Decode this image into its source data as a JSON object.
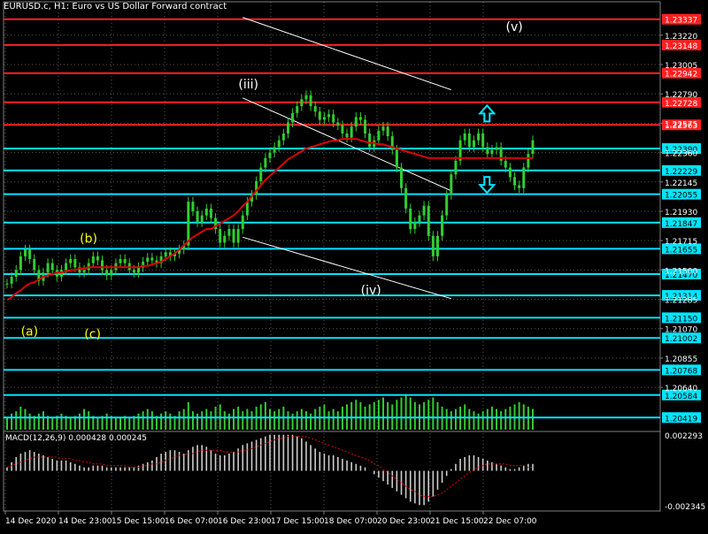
{
  "window": {
    "title": "EURUSD.c, H1:  Euro vs US Dollar Forward contract"
  },
  "colors": {
    "background": "#000000",
    "grid": "#ffffff",
    "candle": "#32cd32",
    "ma": "#e00000",
    "resistance": "#ff2020",
    "support": "#00e5ff",
    "trend": "#ffffff",
    "wave_label": "#ffff00",
    "wave_label_alt": "#ffffff",
    "macd_hist": "#cccccc",
    "macd_signal": "#e00000",
    "volume": "#32cd32",
    "arrow": "#00e5ff"
  },
  "chart_data": {
    "type": "candlestick",
    "symbol": "EURUSD.c",
    "timeframe": "H1",
    "ylim": [
      1.2033,
      1.234
    ],
    "y_ticks": [
      "1.23220",
      "1.23005",
      "1.22790",
      "1.22575",
      "1.22360",
      "1.22145",
      "1.21930",
      "1.21715",
      "1.21500",
      "1.21285",
      "1.21070",
      "1.20855",
      "1.20640"
    ],
    "x_ticks": [
      "14 Dec 2020",
      "14 Dec 23:00",
      "15 Dec 15:00",
      "16 Dec 07:00",
      "16 Dec 23:00",
      "17 Dec 15:00",
      "18 Dec 07:00",
      "20 Dec 23:00",
      "21 Dec 15:00",
      "22 Dec 07:00"
    ],
    "close_series": [
      1.214,
      1.2145,
      1.215,
      1.216,
      1.2165,
      1.2158,
      1.215,
      1.2142,
      1.2148,
      1.2155,
      1.215,
      1.2145,
      1.215,
      1.2155,
      1.2158,
      1.2152,
      1.2148,
      1.215,
      1.2155,
      1.216,
      1.2157,
      1.215,
      1.2146,
      1.215,
      1.2155,
      1.2158,
      1.2155,
      1.215,
      1.2148,
      1.2152,
      1.2156,
      1.2159,
      1.2157,
      1.2155,
      1.216,
      1.2163,
      1.216,
      1.2162,
      1.2165,
      1.2168,
      1.22,
      1.2193,
      1.2185,
      1.219,
      1.2195,
      1.2188,
      1.218,
      1.217,
      1.2175,
      1.218,
      1.217,
      1.218,
      1.219,
      1.22,
      1.2205,
      1.2215,
      1.2225,
      1.2232,
      1.2236,
      1.224,
      1.2245,
      1.225,
      1.2258,
      1.2265,
      1.227,
      1.2275,
      1.2278,
      1.227,
      1.2266,
      1.226,
      1.2262,
      1.2264,
      1.2258,
      1.2256,
      1.225,
      1.2247,
      1.2255,
      1.2262,
      1.226,
      1.225,
      1.224,
      1.2245,
      1.2252,
      1.2255,
      1.2248,
      1.2238,
      1.2225,
      1.221,
      1.2195,
      1.218,
      1.2185,
      1.219,
      1.2197,
      1.2175,
      1.216,
      1.2175,
      1.219,
      1.2205,
      1.222,
      1.223,
      1.2245,
      1.225,
      1.224,
      1.2245,
      1.225,
      1.224,
      1.2235,
      1.2238,
      1.224,
      1.223,
      1.2225,
      1.2218,
      1.2212,
      1.221,
      1.2225,
      1.2235,
      1.2245
    ],
    "ma_series": [
      1.2128,
      1.213,
      1.2133,
      1.2135,
      1.2138,
      1.214,
      1.2141,
      1.2143,
      1.2145,
      1.2146,
      1.2147,
      1.2148,
      1.2148,
      1.2149,
      1.215,
      1.215,
      1.2151,
      1.2151,
      1.2152,
      1.2152,
      1.2152,
      1.2152,
      1.2152,
      1.2152,
      1.2152,
      1.2152,
      1.2152,
      1.2152,
      1.2152,
      1.2152,
      1.2153,
      1.2153,
      1.2154,
      1.2155,
      1.2156,
      1.2158,
      1.216,
      1.2162,
      1.2165,
      1.2168,
      1.2171,
      1.2174,
      1.2176,
      1.2178,
      1.218,
      1.218,
      1.2182,
      1.2184,
      1.2186,
      1.2188,
      1.219,
      1.2193,
      1.2197,
      1.22,
      1.2204,
      1.2208,
      1.2212,
      1.2216,
      1.2219,
      1.2222,
      1.2225,
      1.2228,
      1.2231,
      1.2233,
      1.2235,
      1.2237,
      1.2239,
      1.224,
      1.2241,
      1.2242,
      1.2243,
      1.2244,
      1.2245,
      1.2245,
      1.2246,
      1.2246,
      1.2246,
      1.2246,
      1.2245,
      1.2244,
      1.2243,
      1.2243,
      1.2242,
      1.2242,
      1.2241,
      1.224,
      1.2239,
      1.2238,
      1.2237,
      1.2236,
      1.2235,
      1.2234,
      1.2233,
      1.2232,
      1.2232,
      1.2232,
      1.2232,
      1.2232,
      1.2232,
      1.2232,
      1.2232,
      1.2232,
      1.2232,
      1.2232,
      1.2232,
      1.2232,
      1.2232,
      1.2232,
      1.2232,
      1.2232,
      1.2232,
      1.2232,
      1.2232,
      1.2232,
      1.2232,
      1.2232,
      1.2232
    ],
    "horizontal_levels": [
      {
        "label": "1.23337",
        "value": 1.23337,
        "kind": "resistance"
      },
      {
        "label": "1.23148",
        "value": 1.23148,
        "kind": "resistance"
      },
      {
        "label": "1.22942",
        "value": 1.22942,
        "kind": "resistance"
      },
      {
        "label": "1.22728",
        "value": 1.22728,
        "kind": "resistance"
      },
      {
        "label": "1.22563",
        "value": 1.22563,
        "kind": "resistance"
      },
      {
        "label": "1.22390",
        "value": 1.2239,
        "kind": "support"
      },
      {
        "label": "1.22229",
        "value": 1.22229,
        "kind": "support"
      },
      {
        "label": "1.22055",
        "value": 1.22055,
        "kind": "support"
      },
      {
        "label": "1.21847",
        "value": 1.21847,
        "kind": "support"
      },
      {
        "label": "1.21655",
        "value": 1.21655,
        "kind": "support"
      },
      {
        "label": "1.21470",
        "value": 1.2147,
        "kind": "support"
      },
      {
        "label": "1.21314",
        "value": 1.21314,
        "kind": "support"
      },
      {
        "label": "1.21150",
        "value": 1.2115,
        "kind": "support"
      },
      {
        "label": "1.21002",
        "value": 1.21002,
        "kind": "support"
      },
      {
        "label": "1.20768",
        "value": 1.20768,
        "kind": "support"
      },
      {
        "label": "1.20584",
        "value": 1.20584,
        "kind": "support"
      },
      {
        "label": "1.20419",
        "value": 1.20419,
        "kind": "support"
      }
    ],
    "trendlines": [
      {
        "x1": 52,
        "y1": 1.2335,
        "x2": 98,
        "y2": 1.2282
      },
      {
        "x1": 52,
        "y1": 1.2276,
        "x2": 98,
        "y2": 1.2208
      },
      {
        "x1": 52,
        "y1": 1.2174,
        "x2": 98,
        "y2": 1.2129
      }
    ],
    "wave_labels": [
      {
        "text": "(a)",
        "bar": 5,
        "price": 1.2102,
        "style": "yellow"
      },
      {
        "text": "(b)",
        "bar": 18,
        "price": 1.217,
        "style": "yellow"
      },
      {
        "text": "(c)",
        "bar": 19,
        "price": 1.21,
        "style": "yellow"
      },
      {
        "text": "(iii)",
        "bar": 53,
        "price": 1.2283,
        "style": "white"
      },
      {
        "text": "(iv)",
        "bar": 80,
        "price": 1.2132,
        "style": "white"
      },
      {
        "text": "(v)",
        "bar": 112,
        "price": 1.2325,
        "style": "white"
      }
    ],
    "arrows": [
      {
        "direction": "up",
        "bar": 102,
        "price": 1.2264
      },
      {
        "direction": "down",
        "bar": 102,
        "price": 1.2213
      }
    ],
    "macd": {
      "label": "MACD(12,26,9) 0.000428 0.000245",
      "ylim": [
        -0.002345,
        0.002293
      ],
      "tick_labels": [
        "0.002293",
        "-0.002345"
      ],
      "histogram": [
        0.0002,
        0.0005,
        0.0008,
        0.001,
        0.0011,
        0.0012,
        0.0011,
        0.001,
        0.0009,
        0.0008,
        0.0007,
        0.0006,
        0.0006,
        0.0006,
        0.0005,
        0.0004,
        0.0003,
        0.0002,
        0.0002,
        0.0003,
        0.0003,
        0.0003,
        0.0002,
        0.0002,
        0.0002,
        0.0002,
        0.0002,
        0.0002,
        0.0002,
        0.0003,
        0.0004,
        0.0005,
        0.0006,
        0.0008,
        0.001,
        0.0011,
        0.0012,
        0.0012,
        0.0011,
        0.001,
        0.0012,
        0.0014,
        0.0015,
        0.0015,
        0.0014,
        0.0012,
        0.001,
        0.0009,
        0.0009,
        0.001,
        0.0011,
        0.0013,
        0.0015,
        0.0016,
        0.0017,
        0.0018,
        0.0019,
        0.002,
        0.0021,
        0.0021,
        0.0021,
        0.0021,
        0.0021,
        0.0021,
        0.002,
        0.0019,
        0.0017,
        0.0015,
        0.0013,
        0.0011,
        0.001,
        0.0009,
        0.0009,
        0.0008,
        0.0007,
        0.0006,
        0.0005,
        0.0004,
        0.0003,
        0.0002,
        0.0,
        -0.0002,
        -0.0004,
        -0.0006,
        -0.0008,
        -0.001,
        -0.0012,
        -0.0014,
        -0.0016,
        -0.0018,
        -0.0019,
        -0.002,
        -0.002,
        -0.0018,
        -0.0015,
        -0.0011,
        -0.0007,
        -0.0003,
        0.0001,
        0.0004,
        0.0007,
        0.0008,
        0.0009,
        0.0009,
        0.0008,
        0.0007,
        0.0006,
        0.0005,
        0.0004,
        0.0003,
        0.0002,
        0.0001,
        0.0001,
        0.0002,
        0.0003,
        0.0004,
        0.0004
      ],
      "signal": [
        0.0002,
        0.0003,
        0.0004,
        0.0005,
        0.0006,
        0.0007,
        0.0008,
        0.0008,
        0.0008,
        0.0008,
        0.0008,
        0.0008,
        0.0007,
        0.0007,
        0.0007,
        0.0006,
        0.0006,
        0.0005,
        0.0005,
        0.0004,
        0.0004,
        0.0004,
        0.0003,
        0.0003,
        0.0003,
        0.0003,
        0.0003,
        0.0002,
        0.0002,
        0.0002,
        0.0003,
        0.0003,
        0.0004,
        0.0004,
        0.0005,
        0.0006,
        0.0007,
        0.0008,
        0.0009,
        0.0009,
        0.001,
        0.001,
        0.0011,
        0.0012,
        0.0012,
        0.0012,
        0.0012,
        0.0012,
        0.0011,
        0.0011,
        0.0011,
        0.0011,
        0.0012,
        0.0012,
        0.0013,
        0.0014,
        0.0015,
        0.0016,
        0.0017,
        0.0018,
        0.0019,
        0.0019,
        0.002,
        0.002,
        0.002,
        0.002,
        0.002,
        0.0019,
        0.0018,
        0.0017,
        0.0016,
        0.0015,
        0.0014,
        0.0013,
        0.0012,
        0.0011,
        0.001,
        0.0009,
        0.0008,
        0.0007,
        0.0006,
        0.0004,
        0.0003,
        0.0001,
        -0.0001,
        -0.0003,
        -0.0005,
        -0.0007,
        -0.0009,
        -0.0011,
        -0.0012,
        -0.0014,
        -0.0015,
        -0.0015,
        -0.0015,
        -0.0014,
        -0.0013,
        -0.0011,
        -0.0009,
        -0.0007,
        -0.0005,
        -0.0003,
        -0.0001,
        0.0001,
        0.0002,
        0.0003,
        0.0004,
        0.0004,
        0.0004,
        0.0004,
        0.0004,
        0.0003,
        0.0003,
        0.0003,
        0.0003,
        0.0002,
        0.0002
      ]
    },
    "volume": [
      5,
      7,
      8,
      10,
      9,
      7,
      6,
      7,
      8,
      6,
      5,
      6,
      7,
      6,
      5,
      6,
      7,
      9,
      8,
      6,
      5,
      6,
      7,
      6,
      5,
      5,
      6,
      5,
      6,
      7,
      8,
      9,
      8,
      6,
      7,
      8,
      7,
      6,
      8,
      9,
      12,
      8,
      7,
      8,
      9,
      8,
      10,
      11,
      8,
      7,
      9,
      10,
      8,
      9,
      8,
      10,
      11,
      12,
      9,
      8,
      9,
      10,
      8,
      7,
      8,
      9,
      8,
      7,
      9,
      10,
      11,
      8,
      9,
      8,
      10,
      11,
      12,
      13,
      12,
      10,
      11,
      12,
      13,
      14,
      12,
      11,
      13,
      14,
      15,
      14,
      12,
      11,
      12,
      13,
      14,
      12,
      10,
      9,
      8,
      9,
      10,
      11,
      9,
      8,
      7,
      8,
      9,
      10,
      9,
      8,
      9,
      10,
      11,
      12,
      11,
      10,
      9
    ]
  }
}
